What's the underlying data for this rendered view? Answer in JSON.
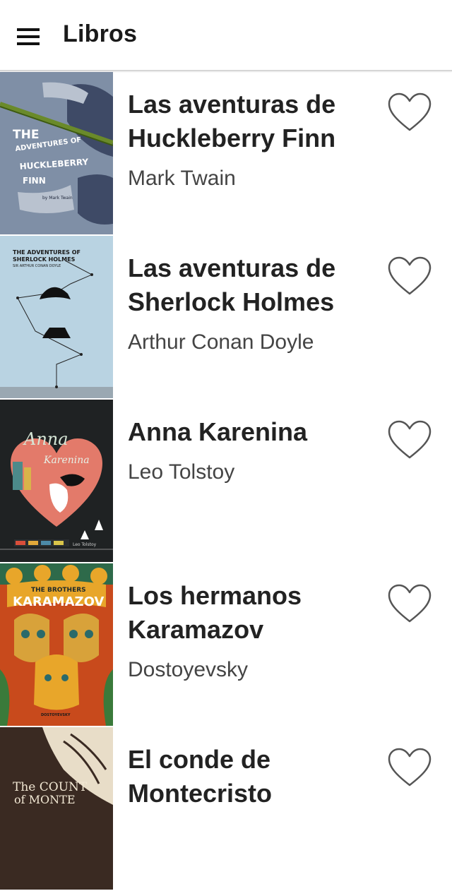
{
  "app_bar": {
    "title": "Libros",
    "menu_icon": "hamburger-menu-icon"
  },
  "books": [
    {
      "title": "Las aventuras de Huckleberry Finn",
      "author": "Mark Twain",
      "cover_text": [
        "THE",
        "ADVENTURES OF",
        "HUCKLEBERRY",
        "FINN",
        "by Mark Twain"
      ],
      "favorite_icon": "heart-outline-icon"
    },
    {
      "title": "Las aventuras de Sherlock Holmes",
      "author": "Arthur Conan Doyle",
      "cover_text": [
        "THE ADVENTURES OF",
        "SHERLOCK HOLMES",
        "SIR ARTHUR CONAN DOYLE"
      ],
      "favorite_icon": "heart-outline-icon"
    },
    {
      "title": "Anna Karenina",
      "author": "Leo Tolstoy",
      "cover_text": [
        "Anna",
        "Karenina",
        "Leo Tolstoy"
      ],
      "favorite_icon": "heart-outline-icon"
    },
    {
      "title": "Los hermanos Karamazov",
      "author": "Dostoyevsky",
      "cover_text": [
        "THE BROTHERS",
        "KARAMAZOV",
        "DOSTOYEVSKY"
      ],
      "favorite_icon": "heart-outline-icon"
    },
    {
      "title": "El conde de Montecristo",
      "author": "",
      "cover_text": [
        "The COUNT",
        "of MONTE"
      ],
      "favorite_icon": "heart-outline-icon"
    }
  ],
  "colors": {
    "app_bar_bg": "#ffffff",
    "title_text": "#222222",
    "author_text": "#444444",
    "heart_stroke": "#555555"
  }
}
